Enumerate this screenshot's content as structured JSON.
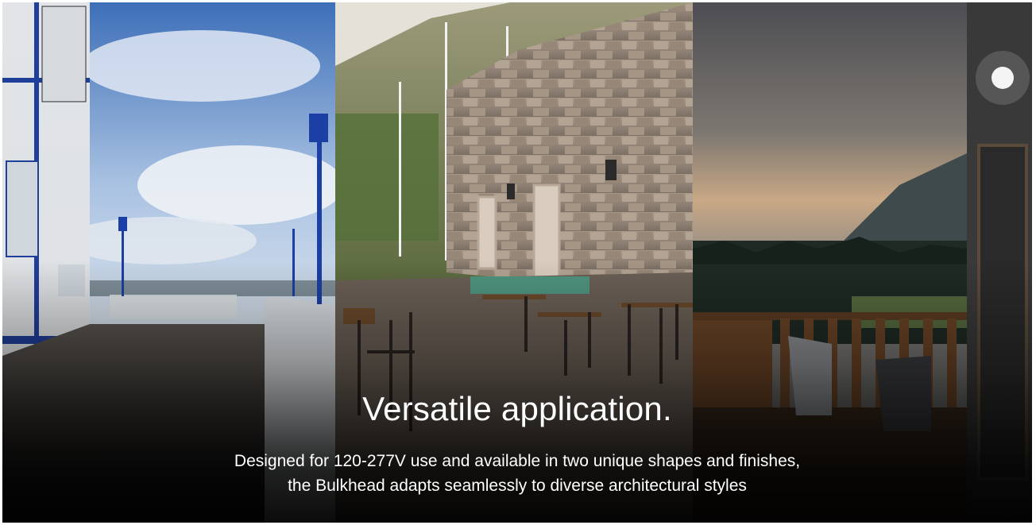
{
  "hero": {
    "headline": "Versatile application.",
    "description_line1": "Designed for 120-277V use and available in two unique shapes and finishes,",
    "description_line2": "the Bulkhead adapts seamlessly to diverse architectural styles"
  },
  "panels": [
    {
      "scene": "seaside-pier-boardwalk-photo"
    },
    {
      "scene": "stone-wall-cafe-terrace-photo"
    },
    {
      "scene": "forest-deck-dusk-photo"
    }
  ],
  "colors": {
    "text": "#ffffff",
    "overlay": "#000000",
    "border": "#ffffff"
  }
}
